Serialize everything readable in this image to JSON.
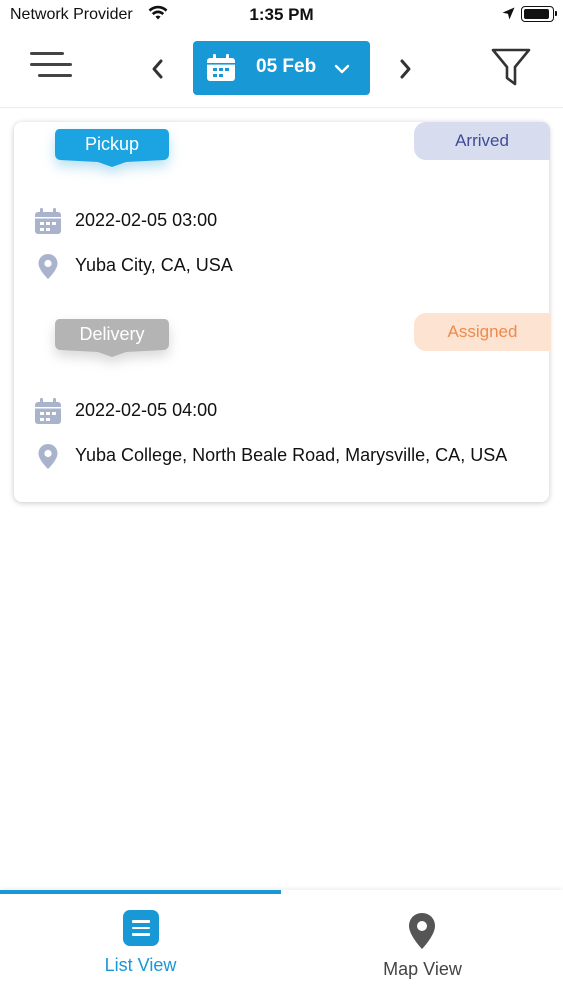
{
  "status_bar": {
    "carrier": "Network Provider",
    "time": "1:35 PM"
  },
  "header": {
    "date_label": "05 Feb",
    "icons": {
      "menu": "menu-icon",
      "prev": "chevron-left-icon",
      "next": "chevron-right-icon",
      "calendar": "calendar-icon",
      "dropdown": "chevron-down-icon",
      "filter": "filter-icon"
    },
    "accent_color": "#1898d5"
  },
  "order": {
    "pickup": {
      "tag": "Pickup",
      "status": "Arrived",
      "datetime": "2022-02-05 03:00",
      "address": "Yuba City, CA, USA"
    },
    "delivery": {
      "tag": "Delivery",
      "status": "Assigned",
      "datetime": "2022-02-05 04:00",
      "address": "Yuba College, North Beale Road, Marysville, CA, USA"
    }
  },
  "colors": {
    "pickup_tag": "#1ba3e2",
    "delivery_tag": "#b4b4b4",
    "arrived_bg": "#d8dcef",
    "arrived_text": "#3d4c97",
    "assigned_bg": "#fde3d2",
    "assigned_text": "#ef8a4a",
    "row_icon": "#aab3cc"
  },
  "bottom_nav": {
    "items": [
      {
        "label": "List View",
        "icon": "list-icon",
        "active": true
      },
      {
        "label": "Map View",
        "icon": "map-pin-icon",
        "active": false
      }
    ]
  }
}
